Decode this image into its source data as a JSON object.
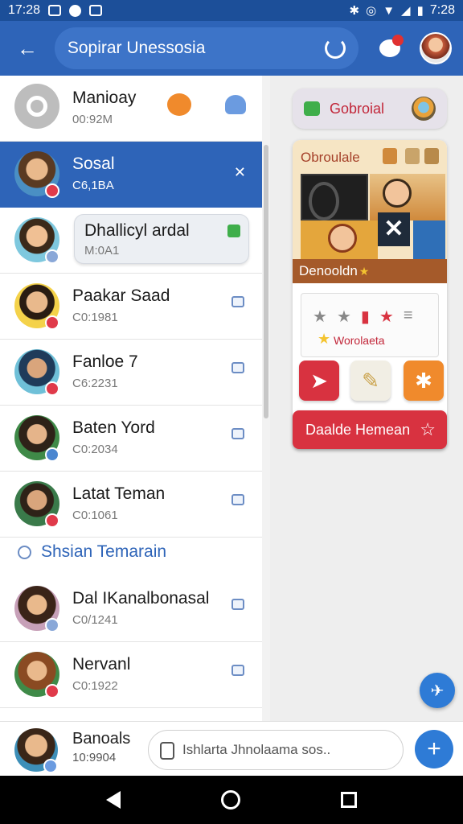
{
  "status_bar": {
    "time_left": "17:28",
    "time_right": "7:28"
  },
  "app_bar": {
    "title": "Sopirar Unessosia"
  },
  "contacts": [
    {
      "name": "Manioay",
      "time": "00:92M"
    },
    {
      "name": "Sosal",
      "time": "C6,1BA"
    },
    {
      "name": "Dhallicyl ardal",
      "time": "M:0A1"
    },
    {
      "name": "Paakar Saad",
      "time": "C0:1981"
    },
    {
      "name": "Fanloe 7",
      "time": "C6:2231"
    },
    {
      "name": "Baten Yord",
      "time": "C0:2034"
    },
    {
      "name": "Latat Teman",
      "time": "C0:1061"
    }
  ],
  "section": {
    "label": "Shsian Temarain"
  },
  "contacts2": [
    {
      "name": "Dal IKanalbonasal",
      "time": "C0/1241"
    },
    {
      "name": "Nervanl",
      "time": "C0:1922"
    }
  ],
  "right_panel": {
    "chip_label": "Gobroial",
    "card_title": "Obroulale",
    "banner_label": "Denooldn",
    "rating_caption": "Worolaeta",
    "cta_label": "Daalde Hemean"
  },
  "composer": {
    "name": "Banoals",
    "time": "10:9904",
    "placeholder": "Ishlarta Jhnolaama sos.."
  },
  "colors": {
    "primary": "#2e64b8",
    "accent_red": "#d83240",
    "fab_blue": "#2e7bd6"
  },
  "icons": [
    "back-arrow-icon",
    "refresh-icon",
    "chat-bubble-icon",
    "search-icon",
    "pin-icon",
    "checkbox-icon",
    "star-icon",
    "plus-icon",
    "attach-icon"
  ]
}
